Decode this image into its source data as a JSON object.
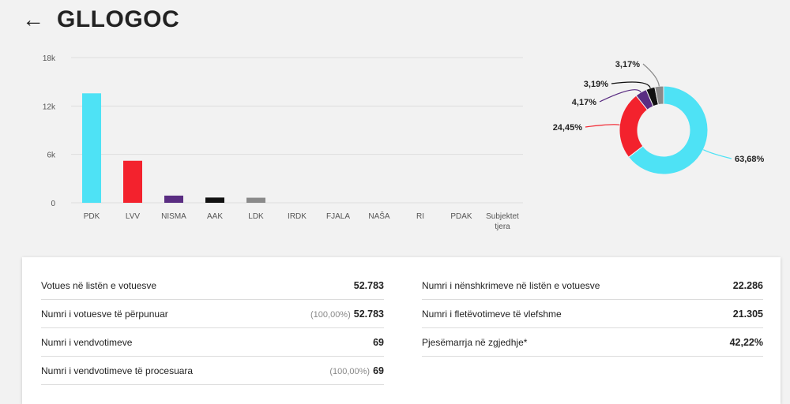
{
  "header": {
    "back_icon": "arrow-left-icon",
    "title": "GLLOGOC"
  },
  "chart_data": [
    {
      "type": "bar",
      "categories": [
        "PDK",
        "LVV",
        "NISMA",
        "AAK",
        "LDK",
        "IRDK",
        "FJALA",
        "NAŠA",
        "RI",
        "PDAK",
        "Subjektet tjera"
      ],
      "values": [
        13570,
        5210,
        890,
        650,
        630,
        0,
        0,
        0,
        0,
        0,
        0
      ],
      "colors": [
        "#4ee2f5",
        "#f3222d",
        "#5a2d82",
        "#111111",
        "#8a8a8a",
        "#cccccc",
        "#cccccc",
        "#cccccc",
        "#cccccc",
        "#cccccc",
        "#cccccc"
      ],
      "ylim": [
        0,
        18000
      ],
      "yticks": [
        0,
        6000,
        12000,
        18000
      ],
      "ytick_labels": [
        "0",
        "6k",
        "12k",
        "18k"
      ],
      "grid": true
    },
    {
      "type": "pie",
      "slices": [
        {
          "value": 63.68,
          "label": "63,68%",
          "color": "#4ee2f5"
        },
        {
          "value": 24.45,
          "label": "24,45%",
          "color": "#f3222d"
        },
        {
          "value": 4.17,
          "label": "4,17%",
          "color": "#5a2d82"
        },
        {
          "value": 3.19,
          "label": "3,19%",
          "color": "#111111"
        },
        {
          "value": 3.17,
          "label": "3,17%",
          "color": "#8a8a8a"
        }
      ]
    }
  ],
  "stats": {
    "left": [
      {
        "label": "Votues në listën e votuesve",
        "percent": "",
        "value": "52.783"
      },
      {
        "label": "Numri i votuesve të përpunuar",
        "percent": "(100,00%)",
        "value": "52.783"
      },
      {
        "label": "Numri i vendvotimeve",
        "percent": "",
        "value": "69"
      },
      {
        "label": "Numri i vendvotimeve të procesuara",
        "percent": "(100,00%)",
        "value": "69"
      }
    ],
    "right": [
      {
        "label": "Numri i nënshkrimeve në listën e votuesve",
        "percent": "",
        "value": "22.286"
      },
      {
        "label": "Numri i fletëvotimeve të vlefshme",
        "percent": "",
        "value": "21.305"
      },
      {
        "label": "Pjesëmarrja në zgjedhje*",
        "percent": "",
        "value": "42,22%"
      }
    ]
  }
}
